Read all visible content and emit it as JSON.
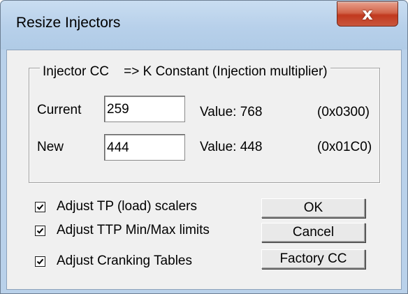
{
  "window": {
    "title": "Resize Injectors",
    "close_glyph": "x"
  },
  "group": {
    "legend": "Injector CC    => K Constant (Injection multiplier)"
  },
  "rows": [
    {
      "label": "Current",
      "input_value": "259",
      "value_text": "Value: 768",
      "hex_text": "(0x0300)"
    },
    {
      "label": "New",
      "input_value": "444",
      "value_text": "Value: 448",
      "hex_text": "(0x01C0)"
    }
  ],
  "options": [
    {
      "label": "Adjust TP (load) scalers",
      "checked": true
    },
    {
      "label": "Adjust TTP Min/Max limits",
      "checked": true
    },
    {
      "label": "Adjust Cranking Tables",
      "checked": true
    }
  ],
  "buttons": {
    "ok": "OK",
    "cancel": "Cancel",
    "factory": "Factory CC"
  },
  "icons": {
    "close": "close-icon",
    "check": "checkmark-icon"
  },
  "colors": {
    "title_frame": "#b9d1ea",
    "close_button": "#c9573d",
    "dialog_face": "#f0f0f0"
  }
}
